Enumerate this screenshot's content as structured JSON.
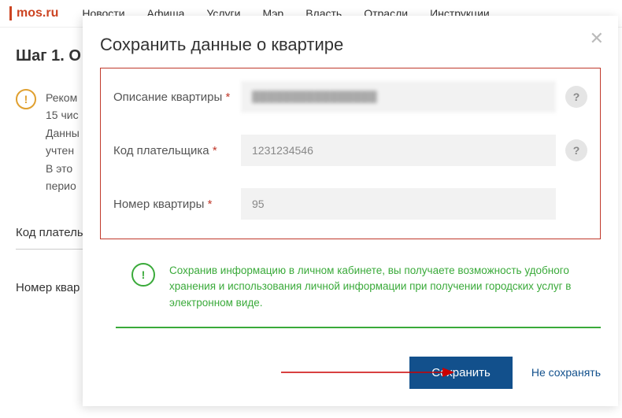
{
  "brand": "mos.ru",
  "nav": [
    "Новости",
    "Афиша",
    "Услуги",
    "Мэр",
    "Власть",
    "Отрасли",
    "Инструкции"
  ],
  "page": {
    "step_title": "Шаг 1. О",
    "reco1": "Реком",
    "reco2": "15 чис",
    "reco3": "Данны",
    "reco4": "учтен",
    "reco5": "В  это",
    "reco6": "перио",
    "label_payer": "Код плателы",
    "label_apt": "Номер квар"
  },
  "modal": {
    "title": "Сохранить данные о квартире",
    "close": "✕",
    "fields": {
      "desc_label": "Описание квартиры",
      "desc_value": "████████████████",
      "payer_label": "Код плательщика",
      "payer_value": "1231234546",
      "apt_label": "Номер квартиры",
      "apt_value": "95"
    },
    "help": "?",
    "info_text": "Сохранив информацию в личном кабинете, вы получаете возможность удобного хранения и использования личной информации при получении городских услуг в электронном виде.",
    "info_mark": "!",
    "save": "Сохранить",
    "cancel": "Не сохранять",
    "asterisk": "*"
  }
}
